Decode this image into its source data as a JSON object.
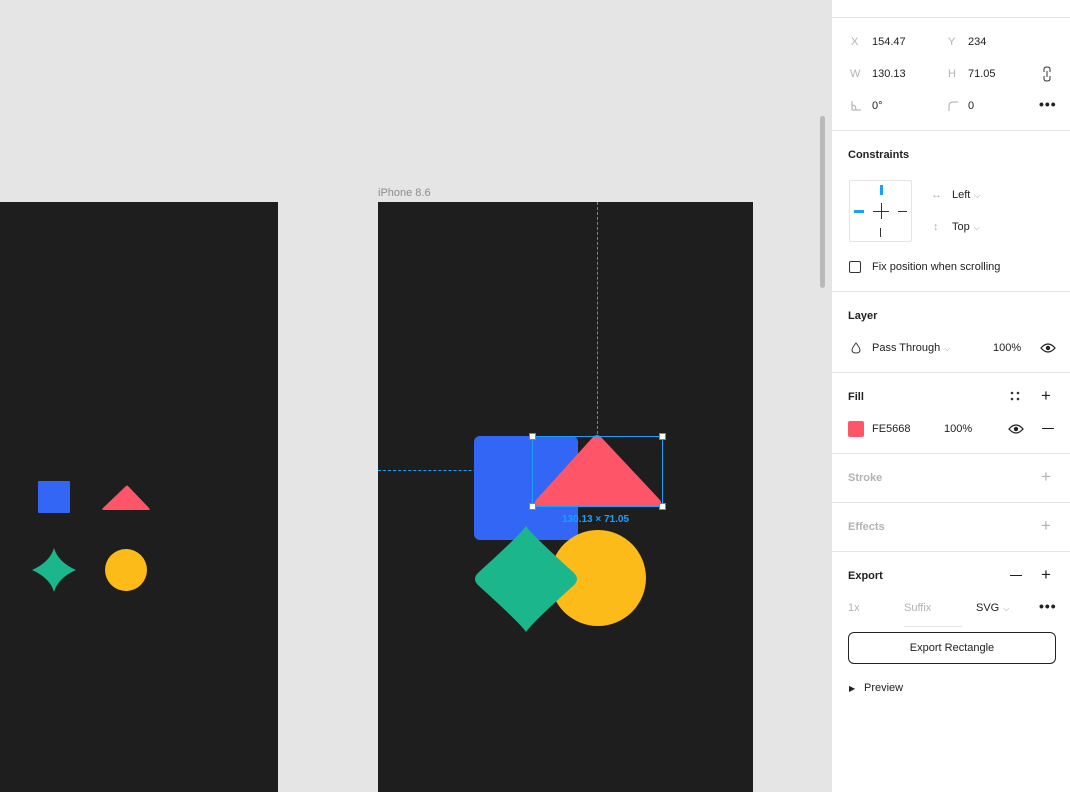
{
  "colors": {
    "canvas_bg": "#e5e5e5",
    "frame_bg": "#1e1e1e",
    "blue": "#3366f5",
    "red": "#FE5668",
    "green": "#1cb68d",
    "yellow": "#fdbb1a",
    "selection": "#18a0fb"
  },
  "canvas": {
    "frame_label": "iPhone 8.6",
    "selection_size_label": "130.13 × 71.05"
  },
  "panel": {
    "position": {
      "x_label": "X",
      "x_value": "154.47",
      "y_label": "Y",
      "y_value": "234",
      "w_label": "W",
      "w_value": "130.13",
      "h_label": "H",
      "h_value": "71.05",
      "rotation_value": "0°",
      "corner_value": "0",
      "icons": [
        "constrain-proportions-icon",
        "rotation-icon",
        "corner-radius-icon",
        "more-icon"
      ]
    },
    "constraints": {
      "title": "Constraints",
      "horizontal": "Left",
      "vertical": "Top",
      "fix_position_label": "Fix position when scrolling"
    },
    "layer": {
      "title": "Layer",
      "blend_mode": "Pass Through",
      "opacity": "100%"
    },
    "fill": {
      "title": "Fill",
      "hex": "FE5668",
      "opacity": "100%"
    },
    "stroke": {
      "title": "Stroke"
    },
    "effects": {
      "title": "Effects"
    },
    "export": {
      "title": "Export",
      "scale": "1x",
      "suffix_placeholder": "Suffix",
      "format": "SVG",
      "button_label": "Export Rectangle",
      "preview_label": "Preview"
    }
  }
}
